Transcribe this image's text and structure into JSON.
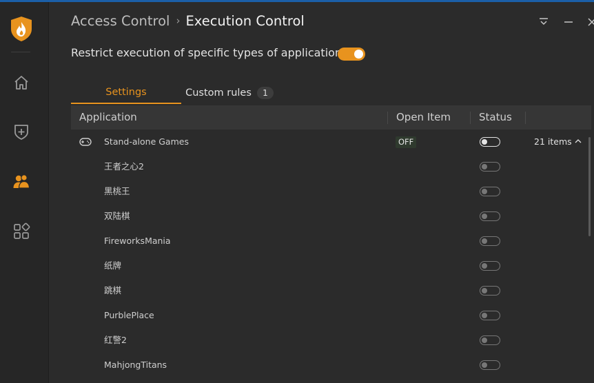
{
  "header": {
    "breadcrumb_parent": "Access Control",
    "breadcrumb_separator": "›",
    "breadcrumb_current": "Execution Control"
  },
  "restrict": {
    "label": "Restrict execution of specific types of applications",
    "enabled": true
  },
  "tabs": {
    "settings": "Settings",
    "custom_rules": "Custom rules",
    "custom_rules_count": "1"
  },
  "table": {
    "col_application": "Application",
    "col_open_item": "Open Item",
    "col_status": "Status"
  },
  "group": {
    "name": "Stand-alone Games",
    "open_item": "OFF",
    "count_label": "21 items",
    "expanded": true
  },
  "apps": [
    {
      "name": "王者之心2",
      "enabled": false
    },
    {
      "name": "黑桃王",
      "enabled": false
    },
    {
      "name": "双陆棋",
      "enabled": false
    },
    {
      "name": "FireworksMania",
      "enabled": false
    },
    {
      "name": "纸牌",
      "enabled": false
    },
    {
      "name": "跳棋",
      "enabled": false
    },
    {
      "name": "PurblePlace",
      "enabled": false
    },
    {
      "name": "红警2",
      "enabled": false
    },
    {
      "name": "MahjongTitans",
      "enabled": false
    }
  ],
  "colors": {
    "accent": "#e8931e",
    "background": "#2b2b2b",
    "sidebar": "#262626",
    "header_row": "#363636",
    "window_strip": "#1b5fa8"
  },
  "icons": {
    "logo": "shield-flame-icon",
    "nav": [
      "home-icon",
      "shield-plus-icon",
      "users-icon",
      "apps-grid-icon"
    ],
    "window": [
      "menu-icon",
      "minimize-icon",
      "close-icon"
    ],
    "group": "gamepad-icon"
  }
}
